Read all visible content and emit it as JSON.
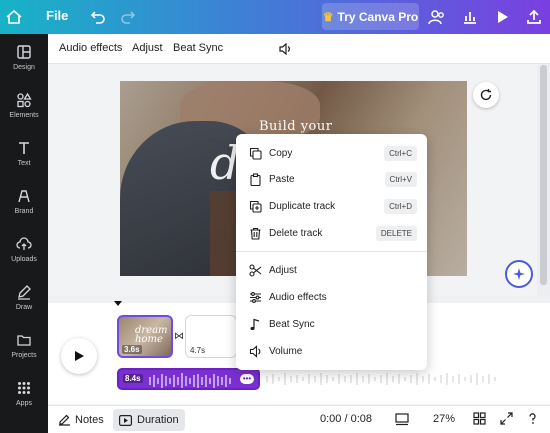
{
  "topbar": {
    "file_label": "File",
    "pro_label": "Try Canva Pro",
    "pro_icon": "crown-icon"
  },
  "sidebar": {
    "items": [
      {
        "label": "Design",
        "icon": "layout-icon"
      },
      {
        "label": "Elements",
        "icon": "shapes-icon"
      },
      {
        "label": "Text",
        "icon": "text-icon"
      },
      {
        "label": "Brand",
        "icon": "brand-icon"
      },
      {
        "label": "Uploads",
        "icon": "upload-cloud-icon"
      },
      {
        "label": "Draw",
        "icon": "pen-icon"
      },
      {
        "label": "Projects",
        "icon": "folder-icon"
      },
      {
        "label": "Apps",
        "icon": "apps-grid-icon"
      }
    ]
  },
  "context_toolbar": {
    "audio_effects": "Audio effects",
    "adjust": "Adjust",
    "beat_sync": "Beat Sync"
  },
  "canvas": {
    "title_text": "Build your",
    "script_text": "dr"
  },
  "timeline": {
    "clip1_duration": "3.6s",
    "clip1_text_line1": "dream",
    "clip1_text_line2": "home",
    "clip2_duration": "4.7s",
    "audio_duration": "8.4s",
    "audio_more": "•••"
  },
  "bottombar": {
    "notes": "Notes",
    "duration": "Duration",
    "time": "0:00 / 0:08",
    "zoom": "27%"
  },
  "context_menu": {
    "items": [
      {
        "label": "Copy",
        "shortcut": "Ctrl+C",
        "icon": "copy-icon"
      },
      {
        "label": "Paste",
        "shortcut": "Ctrl+V",
        "icon": "clipboard-icon"
      },
      {
        "label": "Duplicate track",
        "shortcut": "Ctrl+D",
        "icon": "duplicate-icon"
      },
      {
        "label": "Delete track",
        "shortcut": "DELETE",
        "icon": "trash-icon"
      },
      {
        "label": "Adjust",
        "icon": "scissors-icon"
      },
      {
        "label": "Audio effects",
        "icon": "sliders-icon"
      },
      {
        "label": "Beat Sync",
        "icon": "music-note-icon"
      },
      {
        "label": "Volume",
        "icon": "volume-icon"
      }
    ]
  },
  "colors": {
    "gradient_start": "#17b3c7",
    "gradient_end": "#7a3fe0",
    "audio_track": "#7b2fd0",
    "sidebar_bg": "#18191b",
    "selection": "#6b4de6"
  }
}
